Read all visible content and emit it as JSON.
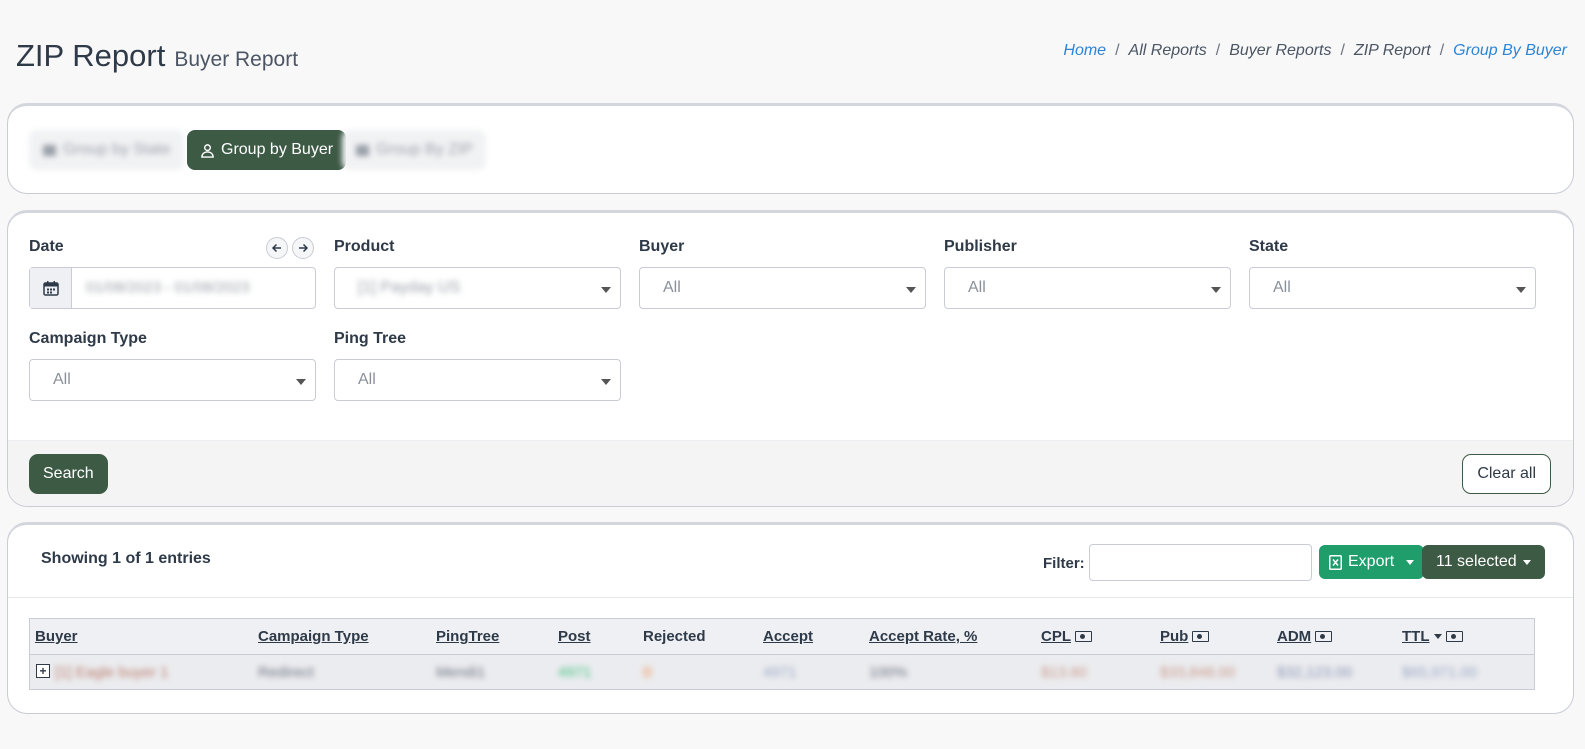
{
  "page": {
    "title": "ZIP Report",
    "subtitle": "Buyer Report"
  },
  "breadcrumb": [
    "Home",
    "All Reports",
    "Buyer Reports",
    "ZIP Report",
    "Group By Buyer"
  ],
  "tabs": [
    {
      "label": "Group by State",
      "icon": "map-icon",
      "active": false
    },
    {
      "label": "Group by Buyer",
      "icon": "user-icon",
      "active": true
    },
    {
      "label": "Group By ZIP",
      "icon": "map-icon",
      "active": false
    }
  ],
  "filters": {
    "date": {
      "label": "Date",
      "value": "01/08/2023 - 01/08/2023"
    },
    "product": {
      "label": "Product",
      "value": "[1] Payday US"
    },
    "buyer": {
      "label": "Buyer",
      "value": "All"
    },
    "publisher": {
      "label": "Publisher",
      "value": "All"
    },
    "state": {
      "label": "State",
      "value": "All"
    },
    "campaign_type": {
      "label": "Campaign Type",
      "value": "All"
    },
    "ping_tree": {
      "label": "Ping Tree",
      "value": "All"
    },
    "search_label": "Search",
    "clear_label": "Clear all"
  },
  "table": {
    "showing": "Showing 1 of 1 entries",
    "filter_label": "Filter:",
    "filter_value": "",
    "export_label": "Export",
    "selected_label": "11 selected",
    "columns": [
      "Buyer",
      "Campaign Type",
      "PingTree",
      "Post",
      "Rejected",
      "Accept",
      "Accept Rate, %",
      "CPL",
      "Pub",
      "ADM",
      "TTL"
    ],
    "rows": [
      {
        "buyer": "[1] Eagle buyer 1",
        "campaign_type": "Redirect",
        "pingtree": "Mendi1",
        "post": "4971",
        "rejected": "0",
        "accept": "4971",
        "accept_rate": "100%",
        "cpl": "$13.60",
        "pub": "$33,848.00",
        "adm": "$32,123.00",
        "ttl": "$65,971.00"
      }
    ]
  },
  "colors": {
    "primary": "#3d5a45",
    "export": "#1f9d6b",
    "link": "#2b85d6"
  }
}
